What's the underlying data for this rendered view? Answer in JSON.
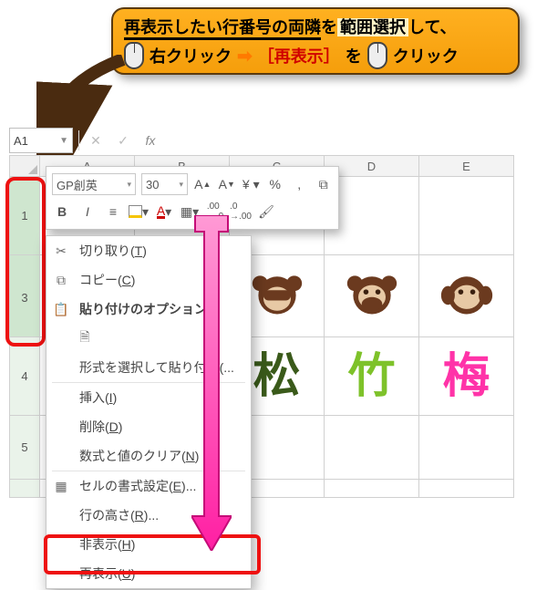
{
  "callout": {
    "line1_a": "再表示したい行番号の両隣",
    "line1_b": "を",
    "line1_c": "範囲選択",
    "line1_d": "して、",
    "right_click": "右クリック",
    "saihyoji": "［再表示］",
    "wo": "を",
    "click": "クリック"
  },
  "namebox": {
    "value": "A1"
  },
  "columns": [
    "A",
    "B",
    "C",
    "D",
    "E"
  ],
  "row_headers": {
    "r1": "1",
    "r3": "3",
    "r4": "4",
    "r5": "5"
  },
  "mini": {
    "font_name": "GP創英",
    "font_size": "30",
    "bold": "B",
    "italic": "I",
    "percent": "%"
  },
  "context_menu": {
    "cut": "切り取り",
    "cut_m": "T",
    "copy": "コピー",
    "copy_m": "C",
    "paste_opt": "貼り付けのオプション:",
    "paste_special": "形式を選択して貼り付け",
    "paste_special_m": "...",
    "insert": "挿入",
    "insert_m": "I",
    "delete": "削除",
    "delete_m": "D",
    "clear": "数式と値のクリア",
    "clear_m": "N",
    "format": "セルの書式設定",
    "format_m": "E",
    "format_e": "...",
    "rowheight": "行の高さ",
    "rowheight_m": "R",
    "rowheight_e": "...",
    "hide": "非表示",
    "hide_m": "H",
    "unhide": "再表示",
    "unhide_m": "U"
  },
  "cells": {
    "r4": {
      "c": "松",
      "d": "竹",
      "e": "梅"
    }
  }
}
